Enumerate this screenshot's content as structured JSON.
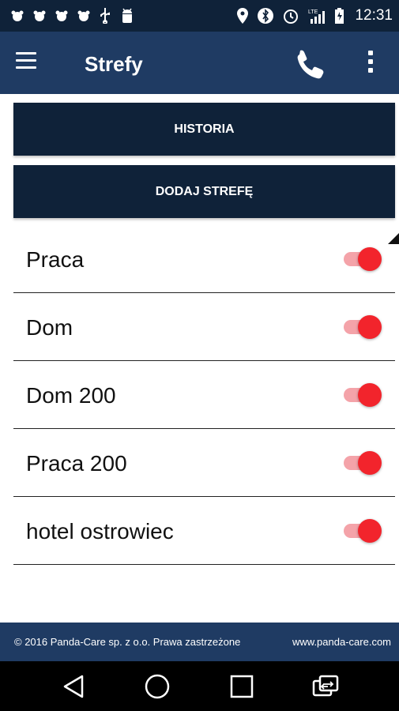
{
  "status_bar": {
    "time": "12:31",
    "left_icons": [
      "panda-notification-icon",
      "panda-notification-icon",
      "panda-notification-icon",
      "panda-notification-icon",
      "usb-icon",
      "android-debug-icon"
    ],
    "right_icons": [
      "location-icon",
      "bluetooth-icon",
      "alarm-icon",
      "lte-signal-icon",
      "battery-icon"
    ]
  },
  "app_bar": {
    "title": "Strefy",
    "background": "#1f3b63"
  },
  "actions": {
    "history_label": "HISTORIA",
    "add_zone_label": "DODAJ STREFĘ"
  },
  "zones": [
    {
      "name": "Praca",
      "enabled": true
    },
    {
      "name": "Dom",
      "enabled": true
    },
    {
      "name": "Dom 200",
      "enabled": true
    },
    {
      "name": "Praca 200",
      "enabled": true
    },
    {
      "name": "hotel ostrowiec",
      "enabled": true
    }
  ],
  "footer": {
    "copyright": "© 2016 Panda-Care sp. z o.o. Prawa zastrzeżone",
    "website": "www.panda-care.com"
  },
  "colors": {
    "dark_navy": "#0f2239",
    "app_blue": "#1f3b63",
    "toggle_on": "#f2242c",
    "toggle_track": "#f4a3a9"
  }
}
